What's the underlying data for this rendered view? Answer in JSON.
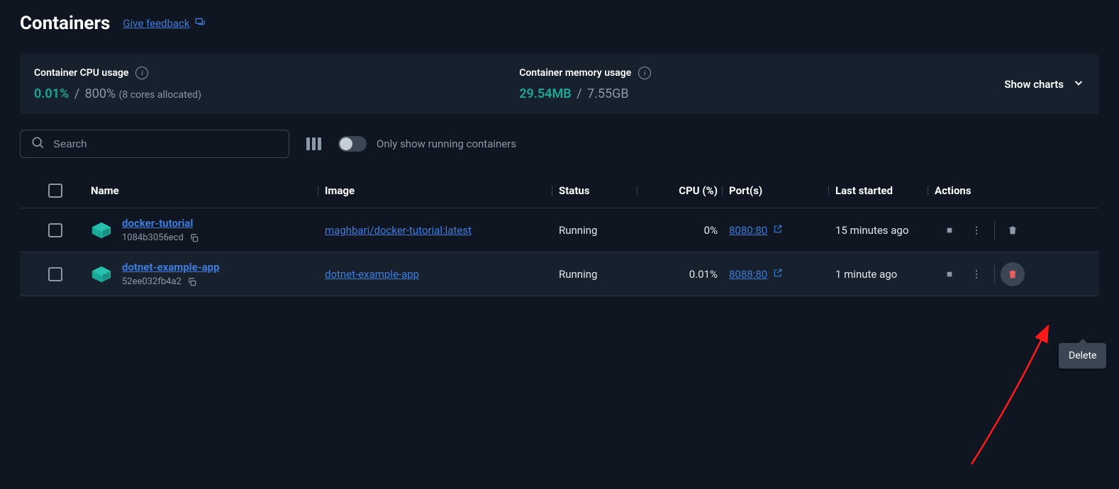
{
  "header": {
    "title": "Containers",
    "feedback": "Give feedback"
  },
  "stats": {
    "cpu": {
      "label": "Container CPU usage",
      "used": "0.01%",
      "sep": "/",
      "total": "800%",
      "note": "(8 cores allocated)"
    },
    "memory": {
      "label": "Container memory usage",
      "used": "29.54MB",
      "sep": "/",
      "total": "7.55GB"
    },
    "show_charts": "Show charts"
  },
  "controls": {
    "search_placeholder": "Search",
    "toggle_label": "Only show running containers"
  },
  "table": {
    "headers": {
      "name": "Name",
      "image": "Image",
      "status": "Status",
      "cpu": "CPU (%)",
      "ports": "Port(s)",
      "last_started": "Last started",
      "actions": "Actions"
    },
    "rows": [
      {
        "name": "docker-tutorial",
        "id": "1084b3056ecd",
        "image": "maghbari/docker-tutorial:latest",
        "status": "Running",
        "cpu": "0%",
        "port": "8080:80",
        "last_started": "15 minutes ago"
      },
      {
        "name": "dotnet-example-app",
        "id": "52ee032fb4a2",
        "image": "dotnet-example-app",
        "status": "Running",
        "cpu": "0.01%",
        "port": "8088:80",
        "last_started": "1 minute ago"
      }
    ]
  },
  "tooltip": {
    "delete": "Delete"
  }
}
